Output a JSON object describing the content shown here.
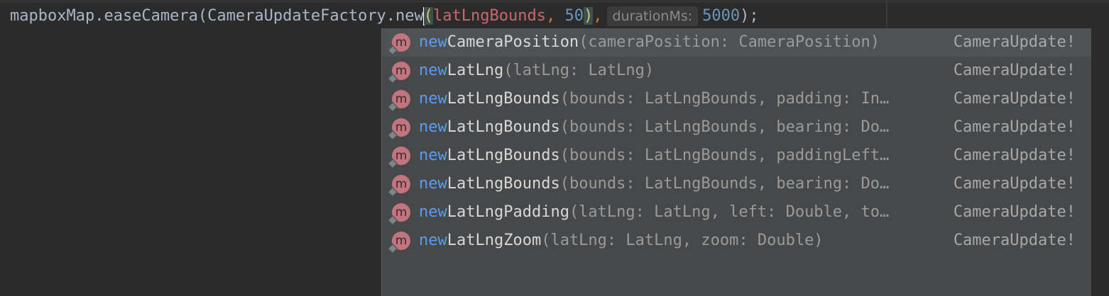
{
  "editor": {
    "code_prefix": "mapboxMap.easeCamera(CameraUpdateFactory.new",
    "open_paren": "(",
    "arg_name": "latLngBounds",
    "comma1": ", ",
    "arg_num": "50",
    "close_paren": ")",
    "comma2": ",",
    "hint_label": "durationMs:",
    "duration_value": "5000",
    "code_suffix": ");"
  },
  "completion": {
    "icon_letter": "m",
    "items": [
      {
        "prefix": "new",
        "rest": "CameraPosition",
        "params": "(cameraPosition: CameraPosition)",
        "return_type": "CameraUpdate!",
        "selected": true
      },
      {
        "prefix": "new",
        "rest": "LatLng",
        "params": "(latLng: LatLng)",
        "return_type": "CameraUpdate!",
        "selected": false
      },
      {
        "prefix": "new",
        "rest": "LatLngBounds",
        "params": "(bounds: LatLngBounds, padding: In…",
        "return_type": "CameraUpdate!",
        "selected": false
      },
      {
        "prefix": "new",
        "rest": "LatLngBounds",
        "params": "(bounds: LatLngBounds, bearing: Do…",
        "return_type": "CameraUpdate!",
        "selected": false
      },
      {
        "prefix": "new",
        "rest": "LatLngBounds",
        "params": "(bounds: LatLngBounds, paddingLeft…",
        "return_type": "CameraUpdate!",
        "selected": false
      },
      {
        "prefix": "new",
        "rest": "LatLngBounds",
        "params": "(bounds: LatLngBounds, bearing: Do…",
        "return_type": "CameraUpdate!",
        "selected": false
      },
      {
        "prefix": "new",
        "rest": "LatLngPadding",
        "params": "(latLng: LatLng, left: Double, to…",
        "return_type": "CameraUpdate!",
        "selected": false
      },
      {
        "prefix": "new",
        "rest": "LatLngZoom",
        "params": "(latLng: LatLng, zoom: Double)",
        "return_type": "CameraUpdate!",
        "selected": false
      }
    ]
  }
}
